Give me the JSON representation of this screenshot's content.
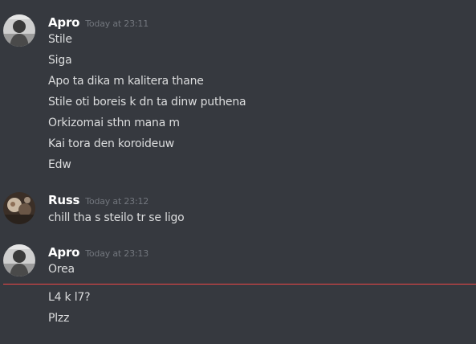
{
  "messages": [
    {
      "author": "Apro",
      "timestamp": "Today at 23:11",
      "avatar": "apro-avatar",
      "lines": [
        "Stile",
        "Siga",
        "Apo ta dika m kalitera thane",
        "Stile oti boreis k dn ta dinw puthena",
        "Orkizomai sthn mana m",
        "Kai tora den koroideuw",
        "Edw"
      ]
    },
    {
      "author": "Russ",
      "timestamp": "Today at 23:12",
      "avatar": "russ-avatar",
      "lines": [
        "chill tha s steilo tr se ligo"
      ]
    },
    {
      "author": "Apro",
      "timestamp": "Today at 23:13",
      "avatar": "apro-avatar",
      "lines": [
        "Orea"
      ]
    }
  ],
  "new_messages": [
    "L4 k l7?",
    "Plzz"
  ],
  "colors": {
    "background": "#36393f",
    "username": "#ffffff",
    "message_text": "#dcddde",
    "timestamp": "#72767d",
    "new_messages_divider": "#f04747"
  }
}
